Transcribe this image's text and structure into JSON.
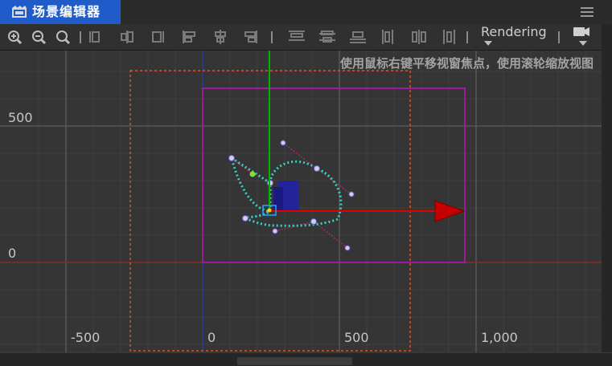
{
  "tab": {
    "title": "场景编辑器",
    "icon": "scene-icon"
  },
  "toolbar": {
    "buttons": [
      "zoom-in-icon",
      "zoom-out-icon",
      "zoom-reset-icon",
      "align-top-icon",
      "align-vcenter-icon",
      "align-bottom-icon",
      "align-left-icon",
      "align-hcenter-icon",
      "align-right-icon",
      "distribute-top-icon",
      "distribute-vcenter-icon",
      "distribute-bottom-icon",
      "distribute-left-icon",
      "distribute-hcenter-icon",
      "distribute-right-icon"
    ],
    "render_mode": "Rendering",
    "camera_icon": "camera-icon"
  },
  "viewport": {
    "hint": "使用鼠标右键平移视窗焦点，使用滚轮缩放视图",
    "y_labels": [
      "500",
      "0"
    ],
    "x_labels": [
      "-500",
      "0",
      "500",
      "1,000"
    ]
  },
  "colors": {
    "tab_active": "#1f5cc9",
    "x_axis_gizmo": "#e00000",
    "y_axis_gizmo": "#00b400",
    "design_resolution": "#9c1a9c",
    "canvas_bounds": "#d9552b",
    "path_points": "#3ad0c0",
    "selected_node": "#23239a"
  }
}
